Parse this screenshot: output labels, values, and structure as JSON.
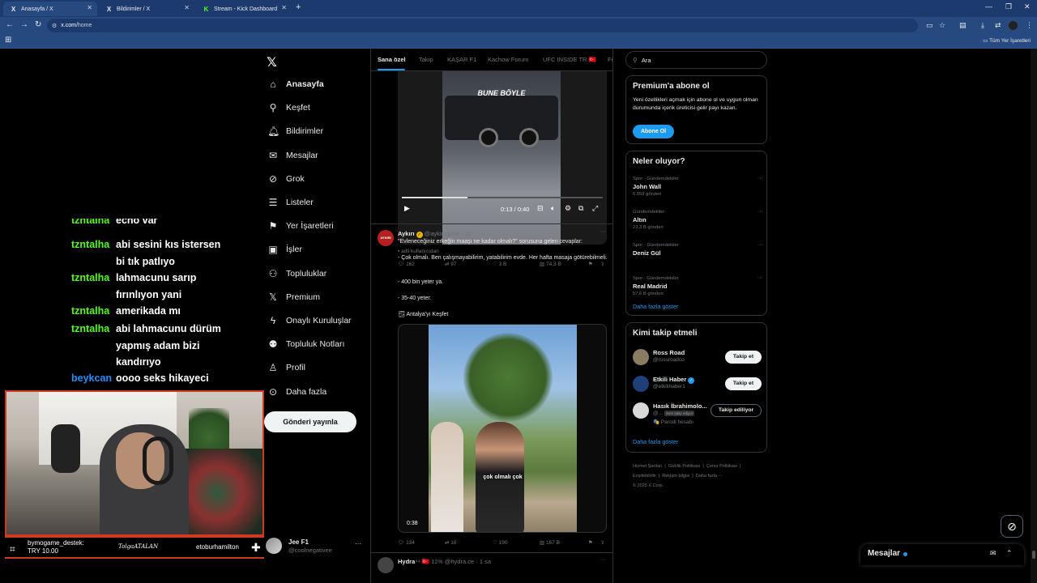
{
  "browser": {
    "tabs": [
      {
        "title": "Anasayfa / X",
        "icon": "X"
      },
      {
        "title": "Bildirimler / X",
        "icon": "X"
      },
      {
        "title": "Stream - Kick Dashboard",
        "icon": "K"
      }
    ],
    "url_host": "x.com",
    "url_path": "/home",
    "bookmarks_label": "Tüm Yer İşaretleri"
  },
  "stream": {
    "chat": [
      {
        "user": "tzntalha",
        "msg": "echo var",
        "color": "#53fc18"
      },
      {
        "user": "tzntalha",
        "msg": "abi sesini kıs istersen bi tık patlıyo",
        "color": "#53fc18"
      },
      {
        "user": "tzntalha",
        "msg": "lahmacunu sarıp fırınlıyon yani",
        "color": "#53fc18"
      },
      {
        "user": "tzntalha",
        "msg": "amerikada mı",
        "color": "#53fc18"
      },
      {
        "user": "tzntalha",
        "msg": "abi lahmacunu dürüm yapmış adam bizi kandırıyo",
        "color": "#53fc18"
      },
      {
        "user": "beykcan",
        "msg": "oooo seks hikayeci yayıncım gelmiş",
        "color": "#1e90ff"
      }
    ],
    "donation": {
      "name": "bymogame_destek:",
      "amount": "TRY 10.00",
      "signature": "TolgaATALAN",
      "user": "etoburhamilton"
    }
  },
  "x": {
    "nav": [
      {
        "label": "Anasayfa",
        "icon": "home-icon",
        "glyph": "⌂"
      },
      {
        "label": "Keşfet",
        "icon": "search-icon",
        "glyph": "⚲"
      },
      {
        "label": "Bildirimler",
        "icon": "bell-icon",
        "glyph": "🔔︎"
      },
      {
        "label": "Mesajlar",
        "icon": "mail-icon",
        "glyph": "✉"
      },
      {
        "label": "Grok",
        "icon": "grok-icon",
        "glyph": "⊘"
      },
      {
        "label": "Listeler",
        "icon": "list-icon",
        "glyph": "☰"
      },
      {
        "label": "Yer İşaretleri",
        "icon": "bookmark-icon",
        "glyph": "⚑"
      },
      {
        "label": "İşler",
        "icon": "briefcase-icon",
        "glyph": "▣"
      },
      {
        "label": "Topluluklar",
        "icon": "people-icon",
        "glyph": "⚇"
      },
      {
        "label": "Premium",
        "icon": "x-premium-icon",
        "glyph": "𝕏"
      },
      {
        "label": "Onaylı Kuruluşlar",
        "icon": "lightning-icon",
        "glyph": "ϟ"
      },
      {
        "label": "Topluluk Notları",
        "icon": "notes-icon",
        "glyph": "⚉"
      },
      {
        "label": "Profil",
        "icon": "user-icon",
        "glyph": "♙"
      },
      {
        "label": "Daha fazla",
        "icon": "more-circle-icon",
        "glyph": "⊙"
      }
    ],
    "post_button": "Gönderi yayınla",
    "profile": {
      "name": "Jee F1",
      "handle": "@coolnegativee"
    },
    "timeline_tabs": [
      "Sana özel",
      "Takip",
      "KAŞAR F1",
      "Kachow Forum",
      "UFC INSIDE TR 🇹🇷",
      "Fo"
    ],
    "tweet1": {
      "video_caption": "BUNE BÖYLE",
      "time": "0:13 / 0:40",
      "progress": 0.325,
      "credit": "adli kullanıcıdan",
      "stats": {
        "replies": "162",
        "reposts": "97",
        "likes": "3 B",
        "views": "74,3 B"
      }
    },
    "tweet2": {
      "name": "Aykırı",
      "handle": "@aykiricomtr",
      "time": "2s",
      "avatar_text": "AYKIRI",
      "lines": [
        "\"Evleneceğiniz erkeğin maaşı ne kadar olmalı?\" sorusuna gelen cevaplar:",
        "- Çok olmalı. Ben çalışmayabilirim, yatabilirim evde. Her hafta masaja götürebilmeli.",
        "- 400 bin yeter ya.",
        "- 35-40 yeter."
      ],
      "tag": "🌫 Antalya'yı Keşfet",
      "video_caption": "çok olmalı çok",
      "video_time": "0:38",
      "stats": {
        "replies": "134",
        "reposts": "16",
        "likes": "190",
        "views": "167 B"
      }
    },
    "tweet3": {
      "name": "Hydra",
      "handle": "@hydra.ce",
      "time": "1 sa",
      "badges": "⁴⁴ 🇹🇷 11% "
    },
    "search_placeholder": "Ara",
    "premium": {
      "title": "Premium'a abone ol",
      "text": "Yeni özellikleri açmak için abone ol ve uygun olman durumunda içerik üreticisi gelir payı kazan.",
      "button": "Abone Ol"
    },
    "trends": {
      "title": "Neler oluyor?",
      "items": [
        {
          "context": "Spor · Gündemdekiler",
          "name": "John Wall",
          "count": "6.559 gönderi"
        },
        {
          "context": "Gündemdekiler",
          "name": "Altın",
          "count": "23,3 B gönderi"
        },
        {
          "context": "Spor · Gündemdekiler",
          "name": "Deniz Gül",
          "count": ""
        },
        {
          "context": "Spor · Gündemdekiler",
          "name": "Real Madrid",
          "count": "57,6 B gönderi"
        }
      ],
      "more": "Daha fazla göster"
    },
    "who_to_follow": {
      "title": "Kimi takip etmeli",
      "items": [
        {
          "name": "Ross Road",
          "handle": "@rossroadco",
          "button": "Takip et",
          "verified": false,
          "color": "#8a7b63"
        },
        {
          "name": "Etkili Haber",
          "handle": "@etkilihaber1",
          "button": "Takip et",
          "verified": true,
          "color": "#1e3f78"
        },
        {
          "name": "Hasık İbrahimolo...",
          "handle": "@...",
          "button": "Takip ediliyor",
          "verified": false,
          "color": "#d9d9d9",
          "badge": "Seni takip ediyor",
          "extra": "🎭 Parodi hesabı"
        }
      ],
      "more": "Daha fazla göster"
    },
    "footer": {
      "links": [
        "Hizmet Şartları",
        "Gizlilik Politikası",
        "Çerez Politikası",
        "Erişilebilirlik",
        "Reklam bilgisi",
        "Daha fazla ···"
      ],
      "copyright": "© 2025 X Corp."
    },
    "messages_title": "Mesajlar"
  }
}
